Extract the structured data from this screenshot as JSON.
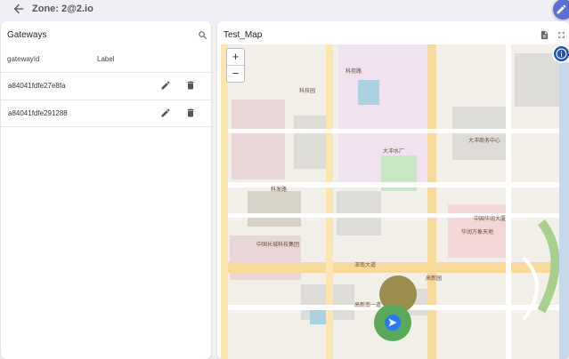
{
  "header": {
    "title": "Zone: 2@2.io",
    "back_icon": "arrow-left-icon",
    "edit_icon": "pencil-icon"
  },
  "gateways": {
    "title": "Gateways",
    "columns": [
      "gatewayId",
      "Label"
    ],
    "rows": [
      {
        "id": "a84041fdfe27e8fa",
        "label": ""
      },
      {
        "id": "a84041fdfe291288",
        "label": ""
      }
    ]
  },
  "map": {
    "title": "Test_Map",
    "zoom_in": "+",
    "zoom_out": "−",
    "labels": [
      "科技园",
      "科苑路",
      "大冲水厂",
      "大冲商务中心",
      "中国华润大厦",
      "深南大道",
      "高新园",
      "华润万象天地",
      "中国长城科技集团",
      "科发路",
      "高新南一道"
    ]
  },
  "colors": {
    "accent": "#5b6fd6",
    "marker_play": "#2979ff",
    "marker_green": "#5aa85a",
    "marker_olive": "#9a8d4e"
  }
}
